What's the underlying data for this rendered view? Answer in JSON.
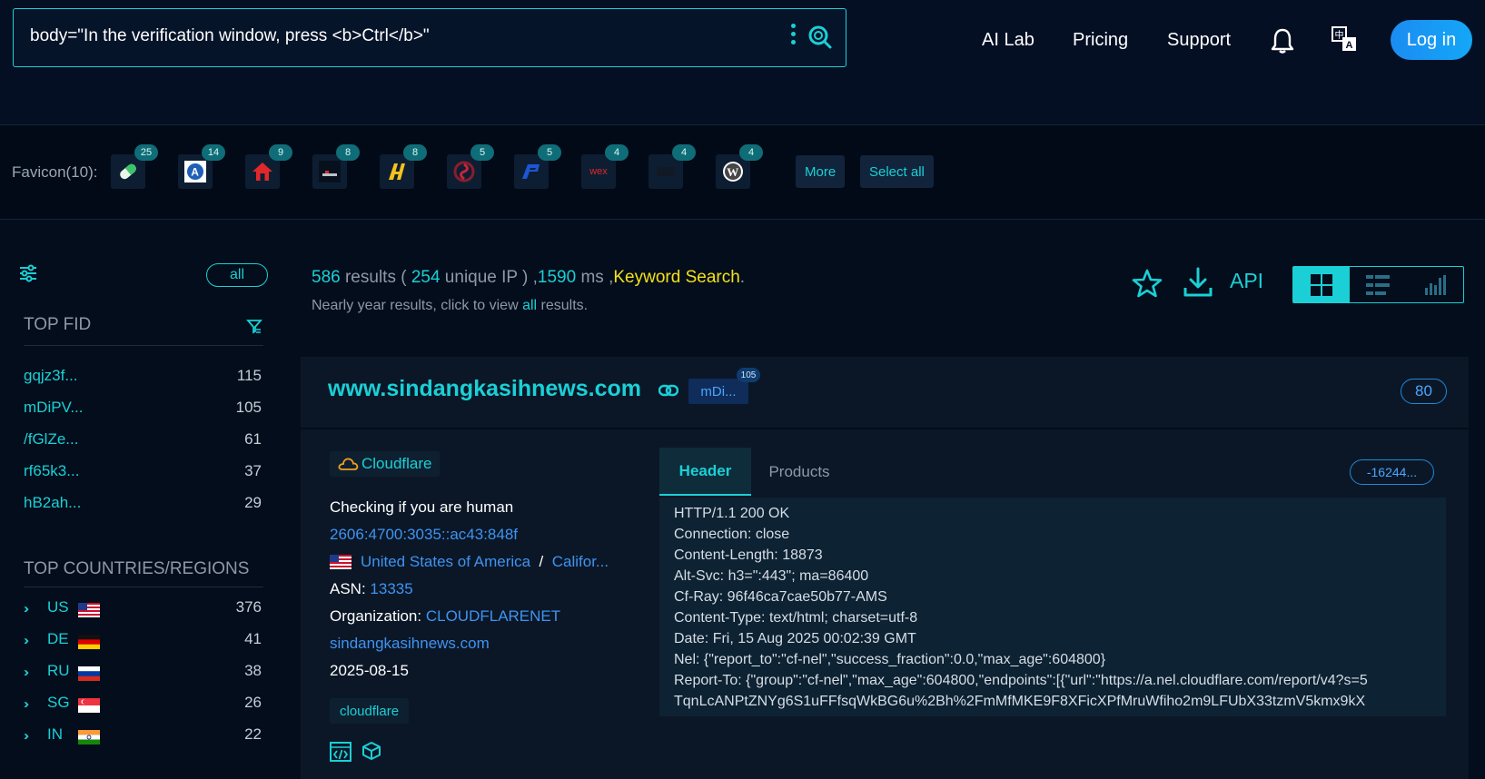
{
  "search": {
    "query": "body=\"In the verification window, press <b>Ctrl</b>\""
  },
  "nav": {
    "ai_lab": "AI Lab",
    "pricing": "Pricing",
    "support": "Support",
    "login": "Log in"
  },
  "favicons": {
    "label": "Favicon(10):",
    "items": [
      {
        "icon": "pill-icon",
        "count": "25"
      },
      {
        "icon": "letter-a-icon",
        "count": "14"
      },
      {
        "icon": "red-house-icon",
        "count": "9"
      },
      {
        "icon": "dark-logo-icon",
        "count": "8"
      },
      {
        "icon": "yellow-h-icon",
        "count": "8"
      },
      {
        "icon": "red-swirl-icon",
        "count": "5"
      },
      {
        "icon": "blue-p-icon",
        "count": "5"
      },
      {
        "icon": "wex-logo-icon",
        "count": "4",
        "text": "wex"
      },
      {
        "icon": "dark-square-icon",
        "count": "4"
      },
      {
        "icon": "wordpress-icon",
        "count": "4"
      }
    ],
    "more": "More",
    "select_all": "Select all"
  },
  "sidebar": {
    "all_label": "all",
    "top_fid_title": "TOP FID",
    "fids": [
      {
        "name": "gqjz3f...",
        "count": "115"
      },
      {
        "name": "mDiPV...",
        "count": "105"
      },
      {
        "name": "/fGlZe...",
        "count": "61"
      },
      {
        "name": "rf65k3...",
        "count": "37"
      },
      {
        "name": "hB2ah...",
        "count": "29"
      }
    ],
    "countries_title": "TOP COUNTRIES/REGIONS",
    "countries": [
      {
        "code": "US",
        "count": "376"
      },
      {
        "code": "DE",
        "count": "41"
      },
      {
        "code": "RU",
        "count": "38"
      },
      {
        "code": "SG",
        "count": "26"
      },
      {
        "code": "IN",
        "count": "22"
      }
    ]
  },
  "results": {
    "count": "586",
    "results_word": " results ( ",
    "unique_ip": "254",
    "unique_ip_word": " unique IP ) ,",
    "ms": "1590",
    "ms_word": " ms ,",
    "mode": "Keyword Search",
    "period": ".",
    "note_prefix": "Nearly year results, click to view ",
    "note_link": "all",
    "note_suffix": " results.",
    "api": "API"
  },
  "card": {
    "host": "www.sindangkasihnews.com",
    "fid_tag": "mDi...",
    "fid_badge": "105",
    "port": "80",
    "cdn": "Cloudflare",
    "title": "Checking if you are human",
    "ip": "2606:4700:3035::ac43:848f",
    "country": "United States of America",
    "separator": "/",
    "region": "Califor...",
    "asn_label": "ASN: ",
    "asn": "13335",
    "org_label": "Organization: ",
    "org": "CLOUDFLARENET",
    "domain": "sindangkasihnews.com",
    "date": "2025-08-15",
    "tag": "cloudflare",
    "tabs": {
      "header": "Header",
      "products": "Products"
    },
    "hash": "-16244...",
    "header_lines": [
      "HTTP/1.1 200 OK",
      "Connection: close",
      "Content-Length: 18873",
      "Alt-Svc: h3=\":443\"; ma=86400",
      "Cf-Ray: 96f46ca7cae50b77-AMS",
      "Content-Type: text/html; charset=utf-8",
      "Date: Fri, 15 Aug 2025 00:02:39 GMT",
      "Nel: {\"report_to\":\"cf-nel\",\"success_fraction\":0.0,\"max_age\":604800}",
      "Report-To: {\"group\":\"cf-nel\",\"max_age\":604800,\"endpoints\":[{\"url\":\"https://a.nel.cloudflare.com/report/v4?s=5",
      "TqnLcANPtZNYg6S1uFFfsqWkBG6u%2Bh%2FmMfMKE9F8XFicXPfMruWfiho2m9LFUbX33tzmV5kmx9kX"
    ]
  },
  "colors": {
    "accent": "#1ad0d6",
    "link": "#3f93f0",
    "keyword": "#f4e01b",
    "login": "#1b8cf2"
  }
}
